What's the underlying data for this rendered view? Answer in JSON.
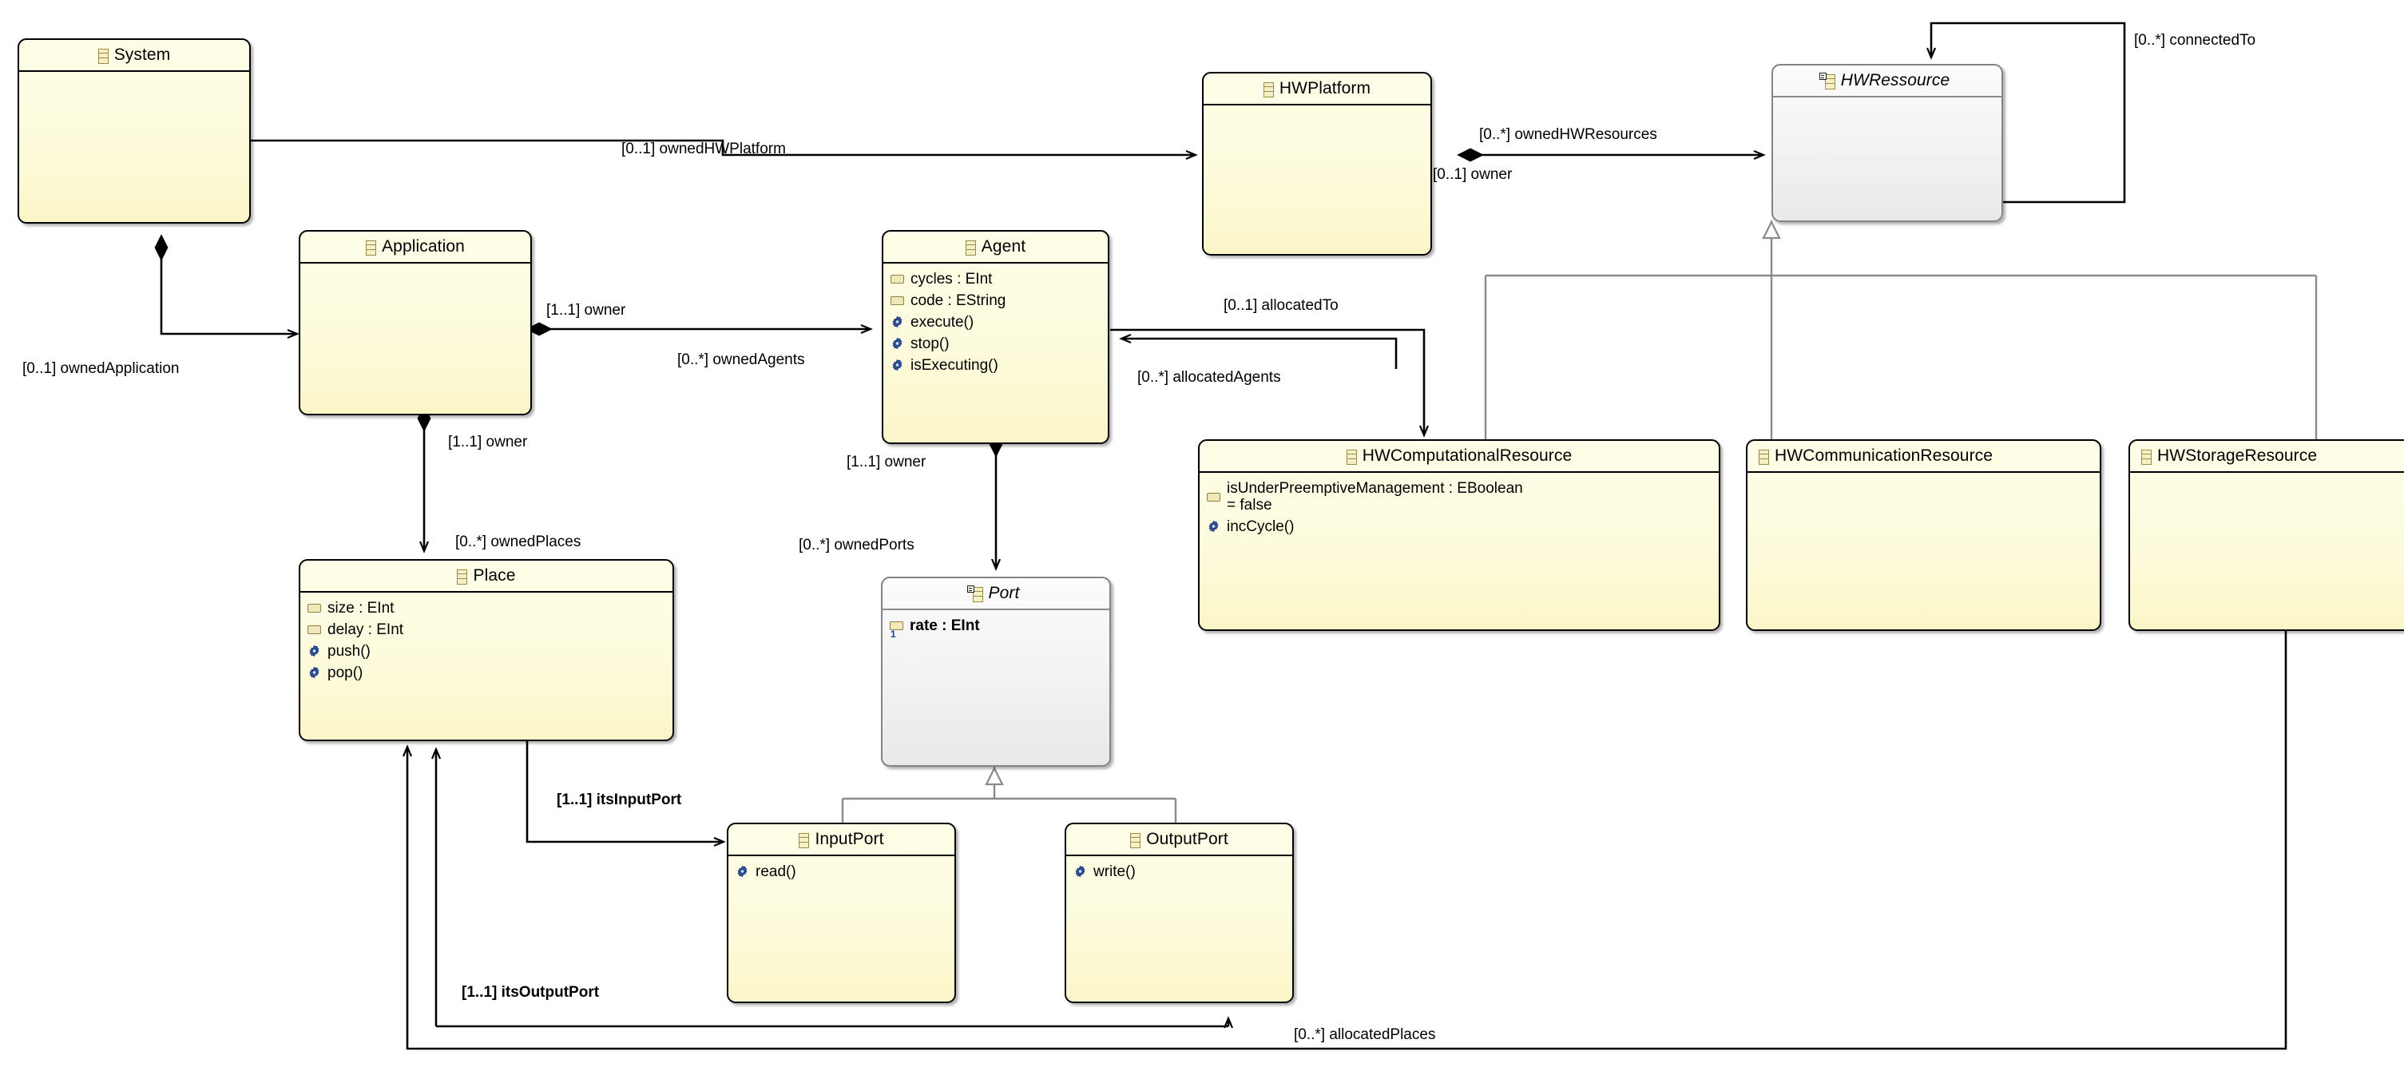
{
  "diagram": {
    "type": "uml-class-diagram",
    "background": "#ffffff",
    "colors": {
      "class_fill": "#fdfbdd",
      "class_border": "#000000",
      "abstract_fill": "#f2f2f2",
      "abstract_border": "#848484",
      "edge": "#000000",
      "generalization_edge": "#8a8a8a",
      "icon_yellow": "#f5f0c8",
      "icon_yellow_border": "#9b8b44",
      "op_icon_blue": "#2c4f9e"
    }
  },
  "classes": [
    {
      "id": "system",
      "name": "System",
      "abstract": false,
      "attributes": [],
      "operations": []
    },
    {
      "id": "application",
      "name": "Application",
      "abstract": false,
      "attributes": [],
      "operations": []
    },
    {
      "id": "agent",
      "name": "Agent",
      "abstract": false,
      "attributes": [
        "cycles : EInt",
        "code : EString"
      ],
      "operations": [
        "execute()",
        "stop()",
        "isExecuting()"
      ]
    },
    {
      "id": "hwplatform",
      "name": "HWPlatform",
      "abstract": false,
      "attributes": [],
      "operations": []
    },
    {
      "id": "hwressource",
      "name": "HWRessource",
      "abstract": true,
      "attributes": [],
      "operations": []
    },
    {
      "id": "place",
      "name": "Place",
      "abstract": false,
      "attributes": [
        "size : EInt",
        "delay : EInt"
      ],
      "operations": [
        "push()",
        "pop()"
      ]
    },
    {
      "id": "port",
      "name": "Port",
      "abstract": true,
      "attributes": [
        "rate : EInt"
      ],
      "attribute_ordinals": [
        "1"
      ],
      "operations": []
    },
    {
      "id": "hwcomputationalresource",
      "name": "HWComputationalResource",
      "abstract": false,
      "attributes": [
        "isUnderPreemptiveManagement : EBoolean",
        "= false"
      ],
      "operations": [
        "incCycle()"
      ]
    },
    {
      "id": "hwcommunicationresource",
      "name": "HWCommunicationResource",
      "abstract": false,
      "attributes": [],
      "operations": []
    },
    {
      "id": "hwstorageresource",
      "name": "HWStorageResource",
      "abstract": false,
      "attributes": [],
      "operations": []
    },
    {
      "id": "inputport",
      "name": "InputPort",
      "abstract": false,
      "attributes": [],
      "operations": [
        "read()"
      ]
    },
    {
      "id": "outputport",
      "name": "OutputPort",
      "abstract": false,
      "attributes": [],
      "operations": [
        "write()"
      ]
    }
  ],
  "associations": [
    {
      "id": "ownedHWPlatform",
      "label": "[0..1] ownedHWPlatform",
      "from": "system",
      "to": "hwplatform",
      "kind": "composition"
    },
    {
      "id": "ownedHWResources",
      "label": "[0..*] ownedHWResources",
      "from": "hwplatform",
      "to": "hwressource",
      "kind": "composition"
    },
    {
      "id": "hwplatform-owner",
      "label": "[0..1] owner",
      "from": "hwressource",
      "to": "hwplatform",
      "kind": "association"
    },
    {
      "id": "connectedTo",
      "label": "[0..*] connectedTo",
      "from": "hwressource",
      "to": "hwressource",
      "kind": "association"
    },
    {
      "id": "ownedApplication",
      "label": "[0..1] ownedApplication",
      "from": "system",
      "to": "application",
      "kind": "composition"
    },
    {
      "id": "application-owner",
      "label": "[1..1] owner",
      "from": "agent",
      "to": "application",
      "kind": "association"
    },
    {
      "id": "ownedAgents",
      "label": "[0..*] ownedAgents",
      "from": "application",
      "to": "agent",
      "kind": "composition"
    },
    {
      "id": "allocatedTo",
      "label": "[0..1] allocatedTo",
      "from": "agent",
      "to": "hwcomputationalresource",
      "kind": "association"
    },
    {
      "id": "allocatedAgents",
      "label": "[0..*] allocatedAgents",
      "from": "hwcomputationalresource",
      "to": "agent",
      "kind": "association"
    },
    {
      "id": "place-owner",
      "label": "[1..1] owner",
      "from": "place",
      "to": "application",
      "kind": "association"
    },
    {
      "id": "ownedPlaces",
      "label": "[0..*] ownedPlaces",
      "from": "application",
      "to": "place",
      "kind": "composition"
    },
    {
      "id": "port-owner",
      "label": "[1..1] owner",
      "from": "port",
      "to": "agent",
      "kind": "association"
    },
    {
      "id": "ownedPorts",
      "label": "[0..*] ownedPorts",
      "from": "agent",
      "to": "port",
      "kind": "composition"
    },
    {
      "id": "itsInputPort",
      "label": "[1..1] itsInputPort",
      "from": "place",
      "to": "inputport",
      "kind": "association",
      "bold": true
    },
    {
      "id": "itsOutputPort",
      "label": "[1..1] itsOutputPort",
      "from": "place",
      "to": "outputport",
      "kind": "association",
      "bold": true
    },
    {
      "id": "allocatedPlaces",
      "label": "[0..*] allocatedPlaces",
      "from": "hwstorageresource",
      "to": "place",
      "kind": "association"
    }
  ],
  "generalizations": [
    {
      "id": "gen-hwcomp",
      "from": "hwcomputationalresource",
      "to": "hwressource"
    },
    {
      "id": "gen-hwcomm",
      "from": "hwcommunicationresource",
      "to": "hwressource"
    },
    {
      "id": "gen-hwstor",
      "from": "hwstorageresource",
      "to": "hwressource"
    },
    {
      "id": "gen-inputport",
      "from": "inputport",
      "to": "port"
    },
    {
      "id": "gen-outputport",
      "from": "outputport",
      "to": "port"
    }
  ]
}
